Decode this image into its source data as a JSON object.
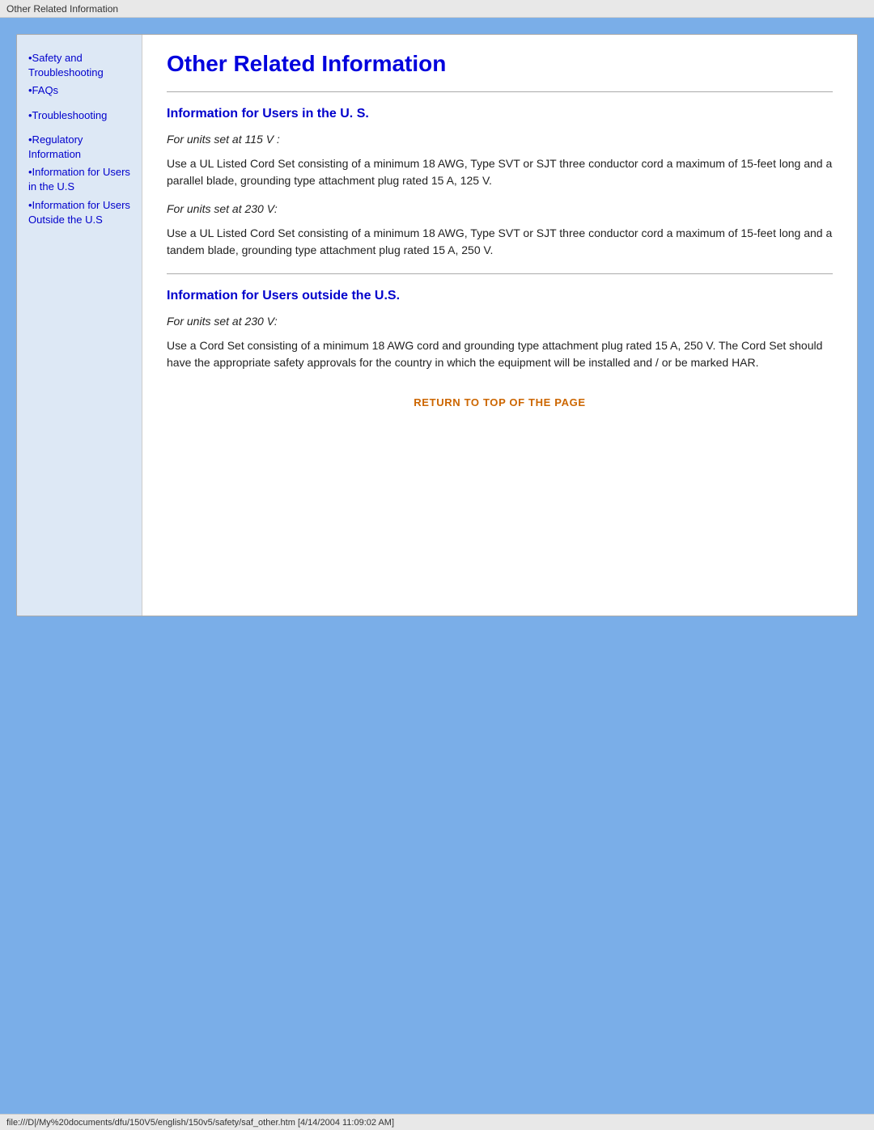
{
  "titlebar": {
    "text": "Other Related Information"
  },
  "statusbar": {
    "text": "file:///D|/My%20documents/dfu/150V5/english/150v5/safety/saf_other.htm [4/14/2004 11:09:02 AM]"
  },
  "sidebar": {
    "links": [
      {
        "label": "Safety and Troubleshooting",
        "href": "#"
      },
      {
        "label": "FAQs",
        "href": "#"
      },
      {
        "label": "Troubleshooting",
        "href": "#"
      },
      {
        "label": "Regulatory Information",
        "href": "#"
      },
      {
        "label": "Information for Users in the U.S",
        "href": "#"
      },
      {
        "label": "Information for Users Outside the U.S",
        "href": "#"
      }
    ]
  },
  "page": {
    "title": "Other Related Information",
    "section1": {
      "heading": "Information for Users in the U. S.",
      "unit1_label": "For units set at 115 V :",
      "unit1_body": "Use a UL Listed Cord Set consisting of a minimum 18 AWG, Type SVT or SJT three conductor cord a maximum of 15-feet long and a parallel blade, grounding type attachment plug rated 15 A, 125 V.",
      "unit2_label": "For units set at 230 V:",
      "unit2_body": "Use a UL Listed Cord Set consisting of a minimum 18 AWG, Type SVT or SJT three conductor cord a maximum of 15-feet long and a tandem blade, grounding type attachment plug rated 15 A, 250 V."
    },
    "section2": {
      "heading": "Information for Users outside the U.S.",
      "unit1_label": "For units set at 230 V:",
      "unit1_body": "Use a Cord Set consisting of a minimum 18 AWG cord and grounding type attachment plug rated 15 A, 250 V. The Cord Set should have the appropriate safety approvals for the country in which the equipment will be installed and / or be marked HAR."
    },
    "return_link": "RETURN TO TOP OF THE PAGE"
  }
}
